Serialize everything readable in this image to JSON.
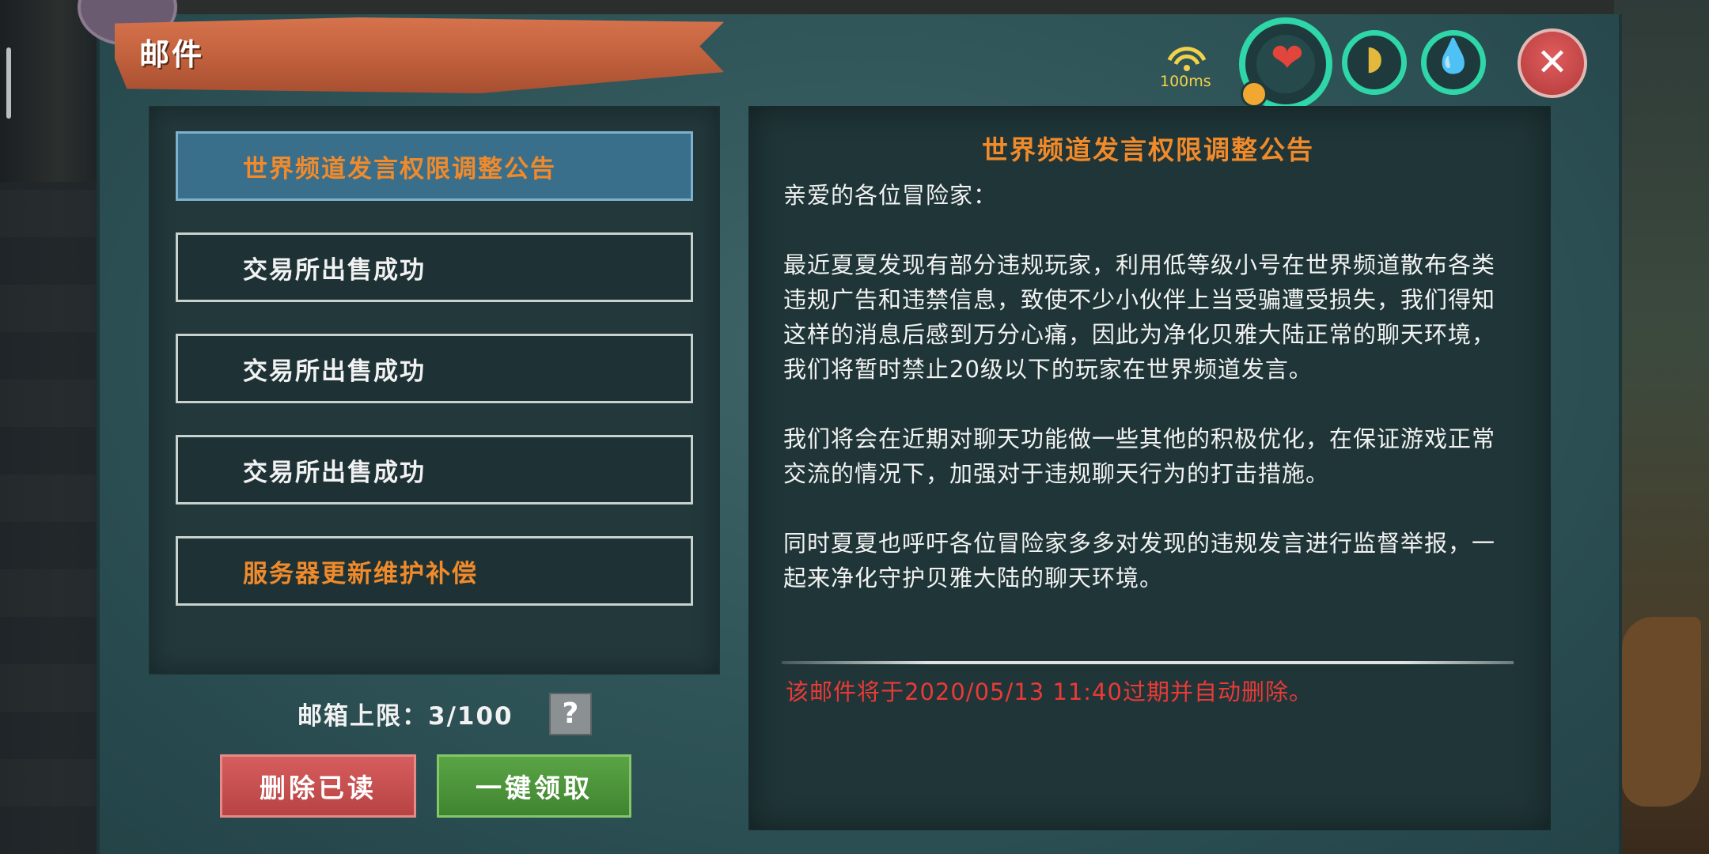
{
  "header": {
    "title": "邮件"
  },
  "hud": {
    "ping": "100ms",
    "heart_icon": "heart-icon",
    "food_icon": "bread-icon",
    "water_icon": "water-drop-icon",
    "close_icon": "close-icon",
    "colors": {
      "ring": "#2fd6a7",
      "heart": "#e2453b",
      "close": "#d04a4a"
    }
  },
  "mail_list": {
    "items": [
      {
        "label": "世界频道发言权限调整公告",
        "selected": true,
        "color": "#f08a2a"
      },
      {
        "label": "交易所出售成功",
        "selected": false,
        "color": "#f2f2f2"
      },
      {
        "label": "交易所出售成功",
        "selected": false,
        "color": "#f2f2f2"
      },
      {
        "label": "交易所出售成功",
        "selected": false,
        "color": "#f2f2f2"
      },
      {
        "label": "服务器更新维护补偿",
        "selected": false,
        "color": "#f08a2a"
      }
    ]
  },
  "footer": {
    "limit_label": "邮箱上限：3/100",
    "help": "?",
    "delete_read": "删除已读",
    "claim_all": "一键领取"
  },
  "content": {
    "title": "世界频道发言权限调整公告",
    "greeting": "亲爱的各位冒险家：",
    "paragraph1": "最近夏夏发现有部分违规玩家，利用低等级小号在世界频道散布各类违规广告和违禁信息，致使不少小伙伴上当受骗遭受损失，我们得知这样的消息后感到万分心痛，因此为净化贝雅大陆正常的聊天环境，我们将暂时禁止20级以下的玩家在世界频道发言。",
    "paragraph2": "我们将会在近期对聊天功能做一些其他的积极优化，在保证游戏正常交流的情况下，加强对于违规聊天行为的打击措施。",
    "paragraph3": "同时夏夏也呼吁各位冒险家多多对发现的违规发言进行监督举报，一起来净化守护贝雅大陆的聊天环境。",
    "expire_notice": "该邮件将于2020/05/13 11:40过期并自动删除。"
  }
}
